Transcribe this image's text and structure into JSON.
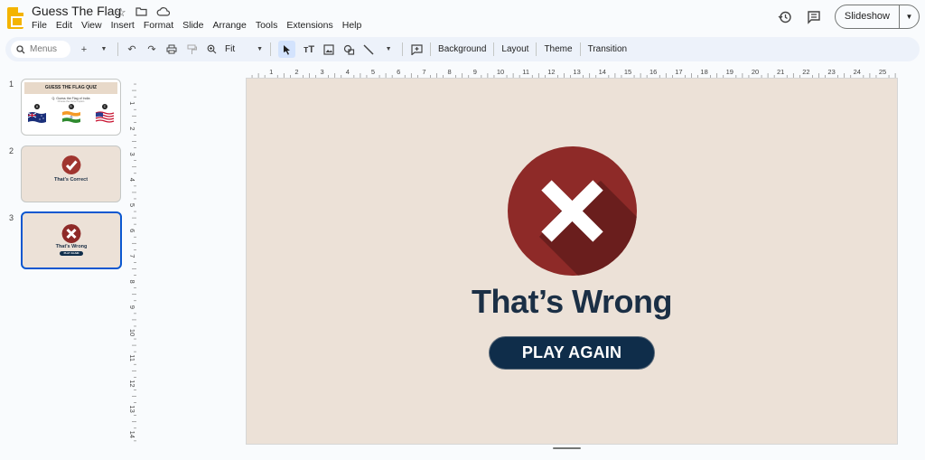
{
  "app": {
    "title": "Guess The Flag",
    "menu": [
      "File",
      "Edit",
      "View",
      "Insert",
      "Format",
      "Slide",
      "Arrange",
      "Tools",
      "Extensions",
      "Help"
    ],
    "slideshow_label": "Slideshow",
    "icons": [
      "star-icon",
      "move-folder-icon",
      "cloud-icon",
      "history-icon",
      "comment-icon"
    ]
  },
  "toolbar": {
    "search_placeholder": "Menus",
    "zoom": "Fit",
    "text_buttons": [
      "Background",
      "Layout",
      "Theme",
      "Transition"
    ]
  },
  "filmstrip": {
    "numbers": [
      "1",
      "2",
      "3"
    ],
    "slide1": {
      "banner": "GUESS THE FLAG QUIZ",
      "question": "Q. Guess the Flag of India",
      "subline": "Choose the correct option",
      "options": [
        "A",
        "B",
        "C"
      ]
    },
    "slide2": {
      "text": "That's Correct"
    },
    "slide3": {
      "text": "That's Wrong",
      "button": "PLAY AGAIN"
    }
  },
  "rulers": {
    "horizontal": [
      "1",
      "2",
      "3",
      "4",
      "5",
      "6",
      "7",
      "8",
      "9",
      "10",
      "11",
      "12",
      "13",
      "14",
      "15",
      "16",
      "17",
      "18",
      "19",
      "20",
      "21",
      "22",
      "23",
      "24",
      "25"
    ],
    "vertical": [
      "1",
      "2",
      "3",
      "4",
      "5",
      "6",
      "7",
      "8",
      "9",
      "10",
      "11",
      "12",
      "13",
      "14"
    ]
  },
  "slide": {
    "headline": "That’s Wrong",
    "button_label": "PLAY AGAIN",
    "colors": {
      "background": "#ece1d7",
      "circle": "#8e2a28",
      "text": "#1b2f45",
      "button": "#0f2d4a",
      "correct": "#a0352f"
    }
  }
}
